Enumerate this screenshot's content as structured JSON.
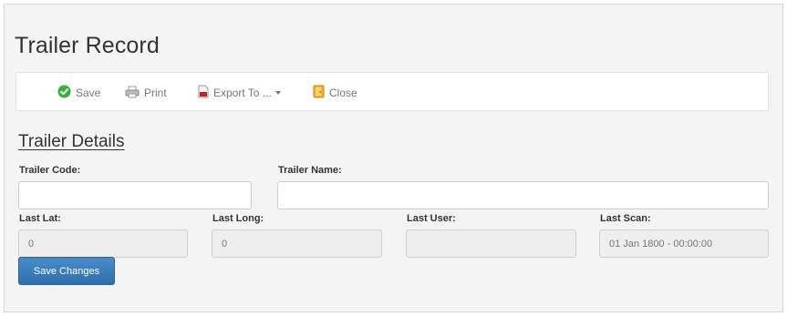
{
  "page": {
    "title": "Trailer Record"
  },
  "toolbar": {
    "save_label": "Save",
    "print_label": "Print",
    "export_label": "Export To ...",
    "close_label": "Close"
  },
  "section": {
    "title": "Trailer Details"
  },
  "fields": {
    "trailer_code": {
      "label": "Trailer Code:",
      "value": ""
    },
    "trailer_name": {
      "label": "Trailer Name:",
      "value": ""
    },
    "last_lat": {
      "label": "Last Lat:",
      "value": "0"
    },
    "last_long": {
      "label": "Last Long:",
      "value": "0"
    },
    "last_user": {
      "label": "Last User:",
      "value": ""
    },
    "last_scan": {
      "label": "Last Scan:",
      "value": "01 Jan 1800 - 00:00:00"
    }
  },
  "actions": {
    "save_changes_label": "Save Changes"
  },
  "colors": {
    "primary": "#337ab7",
    "save_icon": "#3cae3c",
    "close_icon": "#e0a41c",
    "pdf_icon": "#c82020"
  }
}
